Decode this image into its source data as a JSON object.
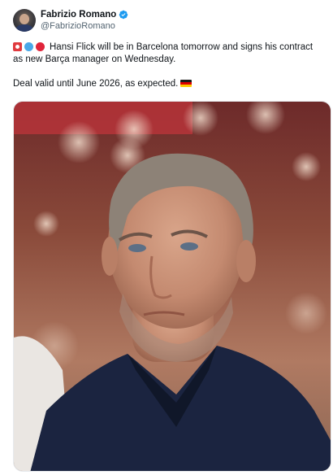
{
  "author": {
    "display_name": "Fabrizio Romano",
    "handle": "@FabrizioRomano",
    "verified": true
  },
  "tweet": {
    "line1": "Hansi Flick will be in Barcelona tomorrow and signs his contract as new Barça manager on Wednesday.",
    "line2": "Deal valid until June 2026, as expected.",
    "leading_emojis": [
      "red-badge-emoji",
      "blue-circle-emoji",
      "red-circle-emoji"
    ],
    "trailing_emoji": "germany-flag-emoji"
  },
  "media": {
    "type": "photo",
    "icon": "photo-of-man-portrait"
  },
  "colors": {
    "verified_blue": "#1d9bf0",
    "handle_gray": "#536471",
    "text": "#0f1419"
  }
}
